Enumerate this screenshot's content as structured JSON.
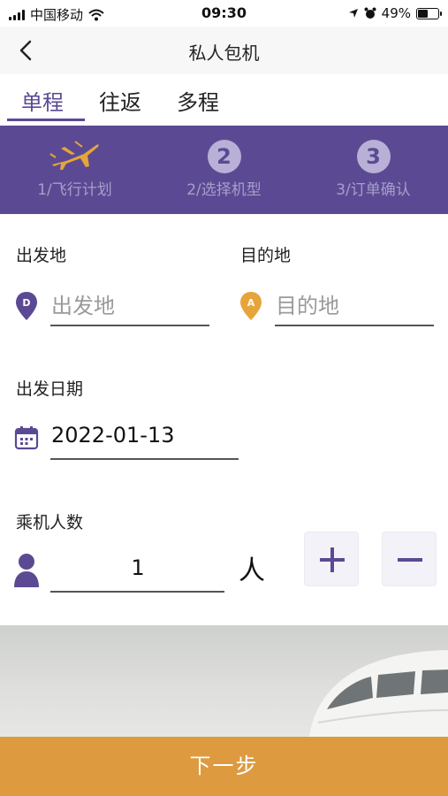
{
  "status_bar": {
    "carrier": "中国移动",
    "time": "09:30",
    "battery": "49%",
    "battery_level": 0.49
  },
  "nav": {
    "title": "私人包机"
  },
  "trip_tabs": [
    {
      "label": "单程",
      "active": true
    },
    {
      "label": "往返",
      "active": false
    },
    {
      "label": "多程",
      "active": false
    }
  ],
  "steps": [
    {
      "number": "",
      "label": "1/飞行计划",
      "icon": "airplane-icon"
    },
    {
      "number": "2",
      "label": "2/选择机型"
    },
    {
      "number": "3",
      "label": "3/订单确认"
    }
  ],
  "form": {
    "departure": {
      "label": "出发地",
      "placeholder": "出发地",
      "badge": "D"
    },
    "destination": {
      "label": "目的地",
      "placeholder": "目的地",
      "badge": "A"
    },
    "date": {
      "label": "出发日期",
      "value": "2022-01-13"
    },
    "passengers": {
      "label": "乘机人数",
      "value": "1",
      "unit": "人"
    }
  },
  "buttons": {
    "next": "下一步"
  },
  "colors": {
    "primary": "#5b4a93",
    "accent": "#dd9a3f",
    "pin_departure": "#5b4a93",
    "pin_destination": "#e6a53a"
  }
}
